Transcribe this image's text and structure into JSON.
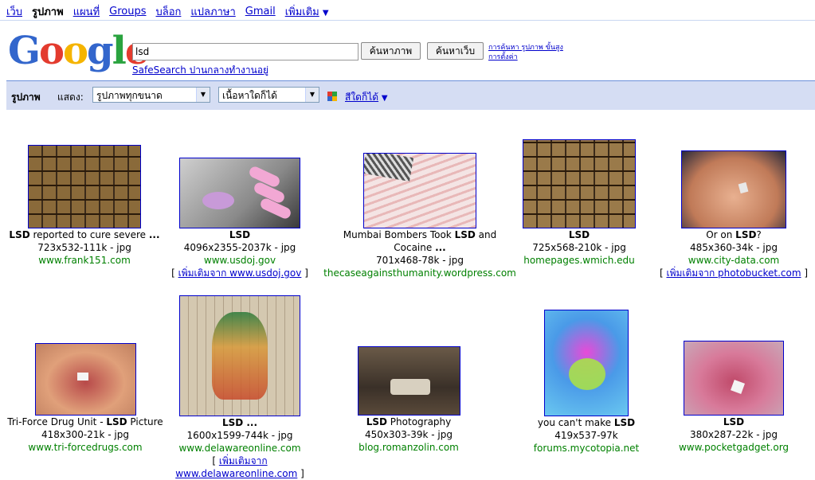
{
  "topnav": {
    "items": [
      "เว็บ",
      "รูปภาพ",
      "แผนที่",
      "Groups",
      "บล็อก",
      "แปลภาษา",
      "Gmail",
      "เพิ่มเติม"
    ],
    "active_index": 1,
    "more_arrow": "▼"
  },
  "logo": {
    "text": "Google",
    "tm": "™"
  },
  "search": {
    "value": "lsd",
    "btn_images": "ค้นหาภาพ",
    "btn_web": "ค้นหาเว็บ",
    "adv_link1": "การค้นหา รูปภาพ ขั้นสูง",
    "adv_link2": "การตั้งค่า",
    "safesearch": "SafeSearch ปานกลางทำงานอยู่"
  },
  "bar": {
    "title": "รูปภาพ",
    "show_label": "แสดง:",
    "size_select": "รูปภาพทุกขนาด",
    "content_select": "เนื้อหาใดก็ได้",
    "color_link": "สีใดก็ได้",
    "color_arrow": "▼",
    "icon_colors": [
      "#e33b2e",
      "#2aa33f",
      "#3366cc",
      "#f5b400"
    ]
  },
  "results": [
    {
      "caption_html": "<b>LSD</b> reported to cure severe <b>...</b>",
      "size": "723x532-111k - jpg",
      "domain": "www.frank151.com",
      "more": null
    },
    {
      "caption_html": "<b>LSD</b>",
      "size": "4096x2355-2037k - jpg",
      "domain": "www.usdoj.gov",
      "more": "เพิ่มเติมจาก www.usdoj.gov"
    },
    {
      "caption_html": "Mumbai Bombers Took <b>LSD</b> and Cocaine <b>...</b>",
      "size": "701x468-78k - jpg",
      "domain": "thecaseagainsthumanity.wordpress.com",
      "more": null
    },
    {
      "caption_html": "<b>LSD</b>",
      "size": "725x568-210k - jpg",
      "domain": "homepages.wmich.edu",
      "more": null
    },
    {
      "caption_html": "Or on <b>LSD</b>?",
      "size": "485x360-34k - jpg",
      "domain": "www.city-data.com",
      "more": "เพิ่มเติมจาก photobucket.com"
    },
    {
      "caption_html": "Tri-Force Drug Unit - <b>LSD</b> Picture",
      "size": "418x300-21k - jpg",
      "domain": "www.tri-forcedrugs.com",
      "more": null
    },
    {
      "caption_html": "<b>LSD ...</b>",
      "size": "1600x1599-744k - jpg",
      "domain": "www.delawareonline.com",
      "more": "เพิ่มเติมจาก www.delawareonline.com"
    },
    {
      "caption_html": "<b>LSD</b> Photography",
      "size": "450x303-39k - jpg",
      "domain": "blog.romanzolin.com",
      "more": null
    },
    {
      "caption_html": "you can't make <b>LSD</b>",
      "size": "419x537-97k",
      "domain": "forums.mycotopia.net",
      "more": null
    },
    {
      "caption_html": "<b>LSD</b>",
      "size": "380x287-22k - jpg",
      "domain": "www.pocketgadget.org",
      "more": null
    }
  ]
}
